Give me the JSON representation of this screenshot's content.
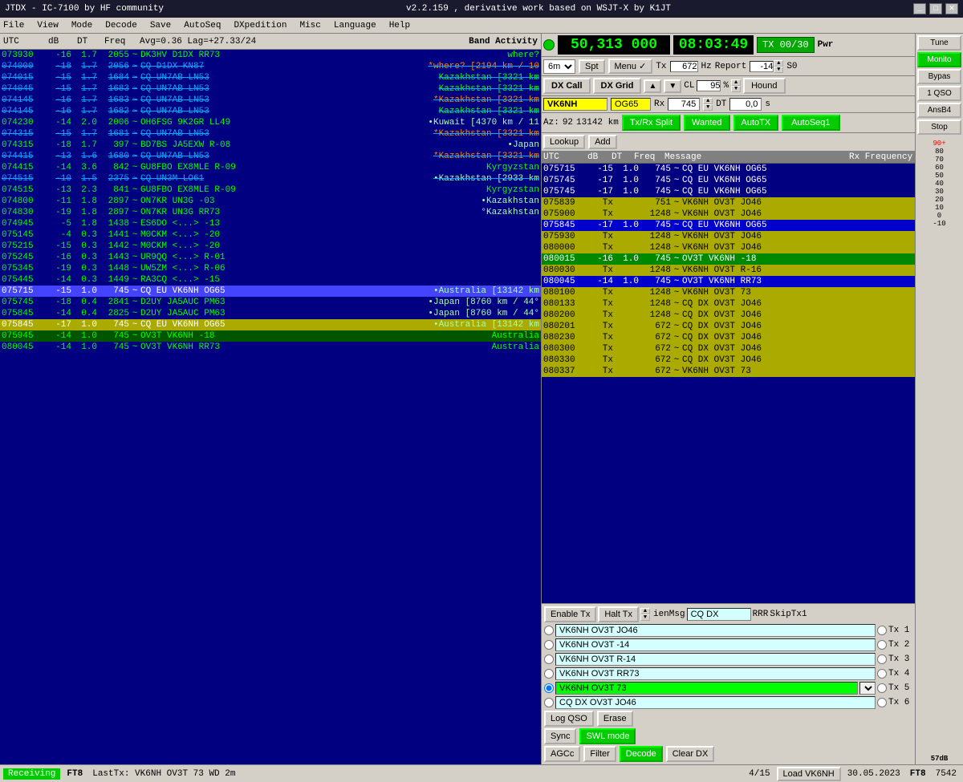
{
  "titleBar": {
    "title": "JTDX - IC-7100  by HF community",
    "version": "v2.2.159 , derivative work based on WSJT-X by K1JT",
    "controls": [
      "_",
      "□",
      "✕"
    ]
  },
  "menuBar": {
    "items": [
      "File",
      "View",
      "Mode",
      "Decode",
      "Save",
      "AutoSeq",
      "DXpedition",
      "Misc",
      "Language",
      "Help"
    ]
  },
  "topBar": {
    "avg": "Avg=0.36  Lag=+27.33/24",
    "utc_label": "UTC",
    "db_label": "dB",
    "dt_label": "DT",
    "freq_label": "Freq",
    "band_activity": "Band Activity"
  },
  "freqDisplay": {
    "frequency": "50,313 000",
    "time": "08:03:49",
    "tx_label": "TX 00/30",
    "pwr_label": "Pwr"
  },
  "controls": {
    "band": "6m",
    "spt_label": "Spt",
    "menu_label": "Menu ✓",
    "tx_label": "Tx",
    "tx_value": "672",
    "hz_label": "Hz",
    "report_label": "Report",
    "report_value": "-14",
    "s0_label": "S0",
    "dx_call_btn": "DX Call",
    "dx_grid_btn": "DX Grid",
    "cl_label": "CL",
    "cl_value": "95",
    "pct_label": "%",
    "hound_btn": "Hound",
    "dx_call_value": "VK6NH",
    "dx_grid_value": "OG65",
    "rx_label": "Rx",
    "rx_value": "745",
    "dt_label": "DT",
    "dt_value": "0,0",
    "s_label": "s",
    "az_label": "Az:",
    "az_value": "92",
    "dist_value": "13142 km",
    "tx_rx_split_btn": "Tx/Rx Split",
    "wanted_btn": "Wanted",
    "autotx_btn": "AutoTX",
    "autoseq_btn": "AutoSeq1",
    "lookup_btn": "Lookup",
    "add_btn": "Add"
  },
  "bandActivityHeaders": {
    "utc": "UTC",
    "db": "dB",
    "dt": "DT",
    "freq": "Freq",
    "message": "Message",
    "rx_freq": "Rx Frequency"
  },
  "logRows": [
    {
      "time": "073930",
      "db": "-16",
      "dt": "1.7",
      "freq": "2055",
      "tilde": "~",
      "msg": "DK3HV D1DX RR73",
      "extra": "where?",
      "style": ""
    },
    {
      "time": "074000",
      "db": "-18",
      "dt": "1.7",
      "freq": "2056",
      "tilde": "~",
      "msg": "CQ D1DX KN87",
      "extra": "*where? [2194 km / 10",
      "style": "strikethrough"
    },
    {
      "time": "074015",
      "db": "-15",
      "dt": "1.7",
      "freq": "1684",
      "tilde": "~",
      "msg": "CQ UN7AB LN53",
      "extra": "Kazakhstan [3321 km",
      "style": "strikethrough"
    },
    {
      "time": "074045",
      "db": "-15",
      "dt": "1.7",
      "freq": "1683",
      "tilde": "~",
      "msg": "CQ UN7AB LN53",
      "extra": "Kazakhstan [3321 km",
      "style": "strikethrough"
    },
    {
      "time": "074145",
      "db": "-16",
      "dt": "1.7",
      "freq": "1683",
      "tilde": "~",
      "msg": "CQ UN7AB LN53",
      "extra": "*Kazakhstan [3321 km",
      "style": "strikethrough"
    },
    {
      "time": "074145",
      "db": "-16",
      "dt": "1.7",
      "freq": "1682",
      "tilde": "~",
      "msg": "CQ UN7AB LN53",
      "extra": "Kazakhstan [3321 km",
      "style": "strikethrough"
    },
    {
      "time": "074230",
      "db": "-14",
      "dt": "2.0",
      "freq": "2006",
      "tilde": "~",
      "msg": "OH6FSG 9K2GR LL49",
      "extra": "•Kuwait [4370 km / 11",
      "style": ""
    },
    {
      "time": "074315",
      "db": "-15",
      "dt": "1.7",
      "freq": "1681",
      "tilde": "~",
      "msg": "CQ UN7AB LN53",
      "extra": "*Kazakhstan [3321 km",
      "style": "strikethrough"
    },
    {
      "time": "074315",
      "db": "-18",
      "dt": "1.7",
      "freq": "397",
      "tilde": "~",
      "msg": "BD7BS JA5EXW R-08",
      "extra": "•Japan",
      "style": ""
    },
    {
      "time": "074415",
      "db": "-13",
      "dt": "1.6",
      "freq": "1680",
      "tilde": "~",
      "msg": "CQ UN7AB LN53",
      "extra": "*Kazakhstan [3321 km",
      "style": "strikethrough"
    },
    {
      "time": "074415",
      "db": "-14",
      "dt": "3.6",
      "freq": "842",
      "tilde": "~",
      "msg": "GU8FBO EX8MLE R-09",
      "extra": "Kyrgyzstan",
      "style": ""
    },
    {
      "time": "074515",
      "db": "-10",
      "dt": "1.5",
      "freq": "2375",
      "tilde": "~",
      "msg": "CQ UN3M LO61",
      "extra": "•Kazakhstan [2933 km",
      "style": "strikethrough"
    },
    {
      "time": "074515",
      "db": "-13",
      "dt": "2.3",
      "freq": "841",
      "tilde": "~",
      "msg": "GU8FBO EX8MLE R-09",
      "extra": "Kyrgyzstan",
      "style": ""
    },
    {
      "time": "074800",
      "db": "-11",
      "dt": "1.8",
      "freq": "2897",
      "tilde": "~",
      "msg": "ON7KR UN3G -03",
      "extra": "•Kazakhstan",
      "style": ""
    },
    {
      "time": "074830",
      "db": "-19",
      "dt": "1.8",
      "freq": "2897",
      "tilde": "~",
      "msg": "ON7KR UN3G RR73",
      "extra": "°Kazakhstan",
      "style": ""
    },
    {
      "time": "074945",
      "db": "-5",
      "dt": "1.8",
      "freq": "1438",
      "tilde": "~",
      "msg": "ES6DO <...> -13",
      "extra": "",
      "style": ""
    },
    {
      "time": "075145",
      "db": "-4",
      "dt": "0.3",
      "freq": "1441",
      "tilde": "~",
      "msg": "M0CKM <...> -20",
      "extra": "",
      "style": ""
    },
    {
      "time": "075215",
      "db": "-15",
      "dt": "0.3",
      "freq": "1442",
      "tilde": "~",
      "msg": "M0CKM <...> -20",
      "extra": "",
      "style": ""
    },
    {
      "time": "075245",
      "db": "-16",
      "dt": "0.3",
      "freq": "1443",
      "tilde": "~",
      "msg": "UR9QQ <...> R-01",
      "extra": "",
      "style": ""
    },
    {
      "time": "075345",
      "db": "-19",
      "dt": "0.3",
      "freq": "1448",
      "tilde": "~",
      "msg": "UW5ZM <...> R-06",
      "extra": "",
      "style": ""
    },
    {
      "time": "075445",
      "db": "-14",
      "dt": "0.3",
      "freq": "1449",
      "tilde": "~",
      "msg": "RA3CQ <...> -15",
      "extra": "",
      "style": ""
    },
    {
      "time": "075715",
      "db": "-15",
      "dt": "1.0",
      "freq": "745",
      "tilde": "~",
      "msg": "CQ EU VK6NH OG65",
      "extra": "•Australia [13142 km",
      "style": "highlight-blue"
    },
    {
      "time": "075745",
      "db": "-18",
      "dt": "0.4",
      "freq": "2841",
      "tilde": "~",
      "msg": "D2UY JA5AUC PM63",
      "extra": "•Japan [8760 km / 44°",
      "style": ""
    },
    {
      "time": "075845",
      "db": "-14",
      "dt": "0.4",
      "freq": "2825",
      "tilde": "~",
      "msg": "D2UY JA5AUC PM63",
      "extra": "•Japan [8760 km / 44°",
      "style": ""
    },
    {
      "time": "075845",
      "db": "-17",
      "dt": "1.0",
      "freq": "745",
      "tilde": "~",
      "msg": "CQ EU VK6NH OG65",
      "extra": "•Australia [13142 km",
      "style": "highlight-yellow"
    },
    {
      "time": "075945",
      "db": "-14",
      "dt": "1.0",
      "freq": "745",
      "tilde": "~",
      "msg": "OV3T VK6NH -18",
      "extra": "Australia",
      "style": "highlight-green"
    },
    {
      "time": "080045",
      "db": "-14",
      "dt": "1.0",
      "freq": "745",
      "tilde": "~",
      "msg": "OV3T VK6NH RR73",
      "extra": "Australia",
      "style": ""
    }
  ],
  "bandRows": [
    {
      "time": "075715",
      "db": "-15",
      "dt": "1.0",
      "freq": "745",
      "tilde": "~",
      "msg": "CQ EU VK6NH OG65",
      "style": ""
    },
    {
      "time": "075745",
      "db": "-17",
      "dt": "1.0",
      "freq": "745",
      "tilde": "~",
      "msg": "CQ EU VK6NH OG65",
      "style": ""
    },
    {
      "time": "075745",
      "db": "-17",
      "dt": "1.0",
      "freq": "745",
      "tilde": "~",
      "msg": "CQ EU VK6NH OG65",
      "style": ""
    },
    {
      "time": "075839",
      "db": "Tx",
      "dt": "",
      "freq": "751",
      "tilde": "~",
      "msg": "VK6NH OV3T JO46",
      "style": "yellow-bg"
    },
    {
      "time": "075900",
      "db": "Tx",
      "dt": "",
      "freq": "1248",
      "tilde": "~",
      "msg": "VK6NH OV3T JO46",
      "style": "yellow-bg"
    },
    {
      "time": "075845",
      "db": "-17",
      "dt": "1.0",
      "freq": "745",
      "tilde": "~",
      "msg": "CQ EU VK6NH OG65",
      "style": "blue-bg"
    },
    {
      "time": "075930",
      "db": "Tx",
      "dt": "",
      "freq": "1248",
      "tilde": "~",
      "msg": "VK6NH OV3T JO46",
      "style": "yellow-bg"
    },
    {
      "time": "080000",
      "db": "Tx",
      "dt": "",
      "freq": "1248",
      "tilde": "~",
      "msg": "VK6NH OV3T JO46",
      "style": "yellow-bg"
    },
    {
      "time": "080015",
      "db": "-16",
      "dt": "1.0",
      "freq": "745",
      "tilde": "~",
      "msg": "OV3T VK6NH -18",
      "style": "green-bg"
    },
    {
      "time": "080030",
      "db": "Tx",
      "dt": "",
      "freq": "1248",
      "tilde": "~",
      "msg": "VK6NH OV3T R-16",
      "style": "yellow-bg"
    },
    {
      "time": "080045",
      "db": "-14",
      "dt": "1.0",
      "freq": "745",
      "tilde": "~",
      "msg": "OV3T VK6NH RR73",
      "style": "blue-bg"
    },
    {
      "time": "080100",
      "db": "Tx",
      "dt": "",
      "freq": "1248",
      "tilde": "~",
      "msg": "VK6NH OV3T 73",
      "style": "yellow-bg"
    },
    {
      "time": "080133",
      "db": "Tx",
      "dt": "",
      "freq": "1248",
      "tilde": "~",
      "msg": "CQ DX OV3T JO46",
      "style": "yellow-bg"
    },
    {
      "time": "080200",
      "db": "Tx",
      "dt": "",
      "freq": "1248",
      "tilde": "~",
      "msg": "CQ DX OV3T JO46",
      "style": "yellow-bg"
    },
    {
      "time": "080201",
      "db": "Tx",
      "dt": "",
      "freq": "672",
      "tilde": "~",
      "msg": "CQ DX OV3T JO46",
      "style": "yellow-bg"
    },
    {
      "time": "080230",
      "db": "Tx",
      "dt": "",
      "freq": "672",
      "tilde": "~",
      "msg": "CQ DX OV3T JO46",
      "style": "yellow-bg"
    },
    {
      "time": "080300",
      "db": "Tx",
      "dt": "",
      "freq": "672",
      "tilde": "~",
      "msg": "CQ DX OV3T JO46",
      "style": "yellow-bg"
    },
    {
      "time": "080330",
      "db": "Tx",
      "dt": "",
      "freq": "672",
      "tilde": "~",
      "msg": "CQ DX OV3T JO46",
      "style": "yellow-bg"
    },
    {
      "time": "080337",
      "db": "Tx",
      "dt": "",
      "freq": "672",
      "tilde": "~",
      "msg": "VK6NH OV3T 73",
      "style": "yellow-bg"
    }
  ],
  "txMessages": [
    {
      "label": "Tx 1",
      "value": "VK6NH OV3T JO46",
      "active": false
    },
    {
      "label": "Tx 2",
      "value": "VK6NH OV3T -14",
      "active": false
    },
    {
      "label": "Tx 3",
      "value": "VK6NH OV3T R-14",
      "active": false
    },
    {
      "label": "Tx 4",
      "value": "VK6NH OV3T RR73",
      "active": false
    },
    {
      "label": "Tx 5",
      "value": "VK6NH OV3T 73",
      "active": true
    },
    {
      "label": "Tx 6",
      "value": "CQ DX OV3T JO46",
      "active": false
    }
  ],
  "bottomButtons": {
    "enable_tx": "Enable Tx",
    "halt_tx": "Halt Tx",
    "gen_msg": "ienMsg",
    "cq_dx": "CQ DX",
    "rrr": "RRR",
    "skip_tx1": "SkipTx1",
    "log_qso": "Log QSO",
    "erase": "Erase",
    "sync": "Sync",
    "swl_mode": "SWL mode",
    "agc": "AGCc",
    "filter": "Filter",
    "decode": "Decode",
    "clear_dx": "Clear DX"
  },
  "statusBar": {
    "receiving": "Receiving",
    "ft8_label": "FT8",
    "last_tx": "LastTx: VK6NH OV3T 73  WD 2m",
    "page": "4/15",
    "load": "Load VK6NH",
    "date": "30.05.2023",
    "ft8_right": "FT8",
    "freq_right": "7542"
  },
  "rightSidebar": {
    "tune_btn": "Tune",
    "monitor_btn": "Monito",
    "bypass_btn": "Bypas",
    "qso_btn": "1 QSO",
    "ansb_btn": "AnsB4",
    "stop_btn": "Stop"
  },
  "dbScale": {
    "values": [
      "+90",
      "+80",
      "+70",
      "+60",
      "+50",
      "+40",
      "+30",
      "+20",
      "+10",
      "0",
      "-10"
    ],
    "marker": "57dB"
  }
}
